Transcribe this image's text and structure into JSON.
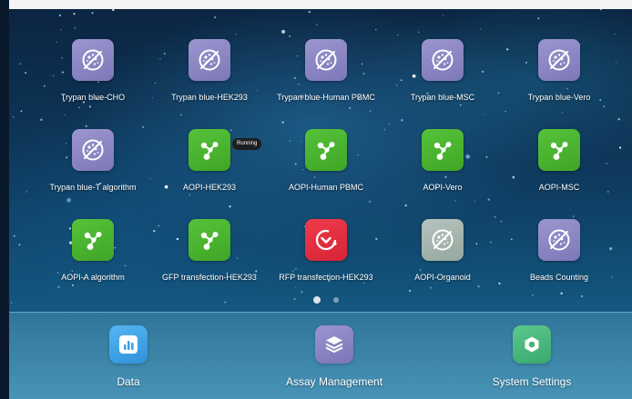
{
  "apps": [
    {
      "label": "Trypan blue-CHO",
      "icon": "trypan-blue-icon",
      "color": "#8a85c4"
    },
    {
      "label": "Trypan blue-HEK293",
      "icon": "trypan-blue-icon",
      "color": "#8a85c4"
    },
    {
      "label": "Trypan blue-Human PBMC",
      "icon": "trypan-blue-icon",
      "color": "#8a85c4"
    },
    {
      "label": "Trypan blue-MSC",
      "icon": "trypan-blue-icon",
      "color": "#8a85c4"
    },
    {
      "label": "Trypan blue-Vero",
      "icon": "trypan-blue-icon",
      "color": "#8a85c4"
    },
    {
      "label": "Trypan blue-T algorithm",
      "icon": "trypan-blue-icon",
      "color": "#8a85c4"
    },
    {
      "label": "AOPI-HEK293",
      "icon": "molecule-icon",
      "color": "#4cb52f",
      "badge": "Running"
    },
    {
      "label": "AOPI-Human PBMC",
      "icon": "molecule-icon",
      "color": "#4cb52f"
    },
    {
      "label": "AOPI-Vero",
      "icon": "molecule-icon",
      "color": "#4cb52f"
    },
    {
      "label": "AOPI-MSC",
      "icon": "molecule-icon",
      "color": "#4cb52f"
    },
    {
      "label": "AOPI-A algorithm",
      "icon": "molecule-icon",
      "color": "#4cb52f"
    },
    {
      "label": "GFP transfection-HEK293",
      "icon": "molecule-icon",
      "color": "#4cb52f"
    },
    {
      "label": "RFP transfection-HEK293",
      "icon": "rfp-icon",
      "color": "#e02f40"
    },
    {
      "label": "AOPI-Organoid",
      "icon": "trypan-blue-icon",
      "color": "#a6b6ae"
    },
    {
      "label": "Beads Counting",
      "icon": "trypan-blue-icon",
      "color": "#8a85c4"
    }
  ],
  "pager": {
    "active_page": 1,
    "total_pages": 2
  },
  "dock": [
    {
      "label": "Data",
      "icon": "chart-icon",
      "color": "#3fa3e6"
    },
    {
      "label": "Assay Management",
      "icon": "layers-icon",
      "color": "#8a85c4"
    },
    {
      "label": "System Settings",
      "icon": "settings-icon",
      "color": "#46b87d"
    }
  ]
}
